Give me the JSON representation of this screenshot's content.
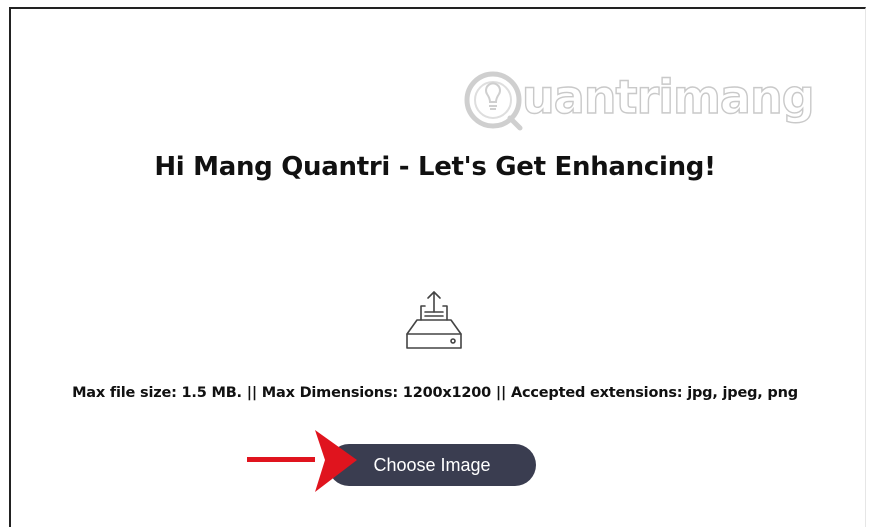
{
  "watermark": {
    "text": "uantrimang"
  },
  "page": {
    "title": "Hi Mang Quantri - Let's Get Enhancing!",
    "upload_info": "Max file size: 1.5 MB. || Max Dimensions: 1200x1200 || Accepted extensions: jpg, jpeg, png",
    "choose_button_label": "Choose Image"
  },
  "icons": {
    "upload": "upload-tray-icon",
    "annotation": "red-arrow-icon",
    "logo": "lightbulb-logo-icon"
  },
  "colors": {
    "button_bg": "#3a3d50",
    "button_text": "#ffffff",
    "arrow": "#e0141e",
    "watermark": "#c9c9c9"
  }
}
